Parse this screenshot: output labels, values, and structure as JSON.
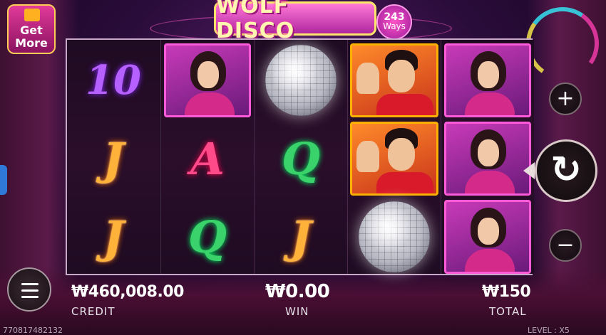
{
  "title": "WOLF DISCO",
  "ways": {
    "number": "243",
    "label": "Ways"
  },
  "get_more": {
    "line1": "Get",
    "line2": "More"
  },
  "reels": [
    [
      {
        "type": "letter",
        "value": "10",
        "style": "c-10"
      },
      {
        "type": "letter",
        "value": "J",
        "style": "c-j"
      },
      {
        "type": "letter",
        "value": "J",
        "style": "c-j"
      }
    ],
    [
      {
        "type": "woman"
      },
      {
        "type": "letter",
        "value": "A",
        "style": "c-a"
      },
      {
        "type": "letter",
        "value": "Q",
        "style": "c-q"
      }
    ],
    [
      {
        "type": "ball"
      },
      {
        "type": "letter",
        "value": "Q",
        "style": "c-q"
      },
      {
        "type": "letter",
        "value": "J",
        "style": "c-j"
      }
    ],
    [
      {
        "type": "man"
      },
      {
        "type": "man"
      },
      {
        "type": "ball"
      }
    ],
    [
      {
        "type": "woman"
      },
      {
        "type": "woman"
      },
      {
        "type": "woman"
      }
    ]
  ],
  "controls": {
    "plus": "+",
    "minus": "−",
    "spin": "↻",
    "menu": "menu"
  },
  "bottom": {
    "credit_amount": "₩460,008.00",
    "credit_label": "CREDIT",
    "win_amount": "₩0.00",
    "win_label": "WIN",
    "total_amount": "₩150",
    "total_label": "TOTAL",
    "round_id": "770817482132",
    "level_label": "LEVEL : X5"
  }
}
